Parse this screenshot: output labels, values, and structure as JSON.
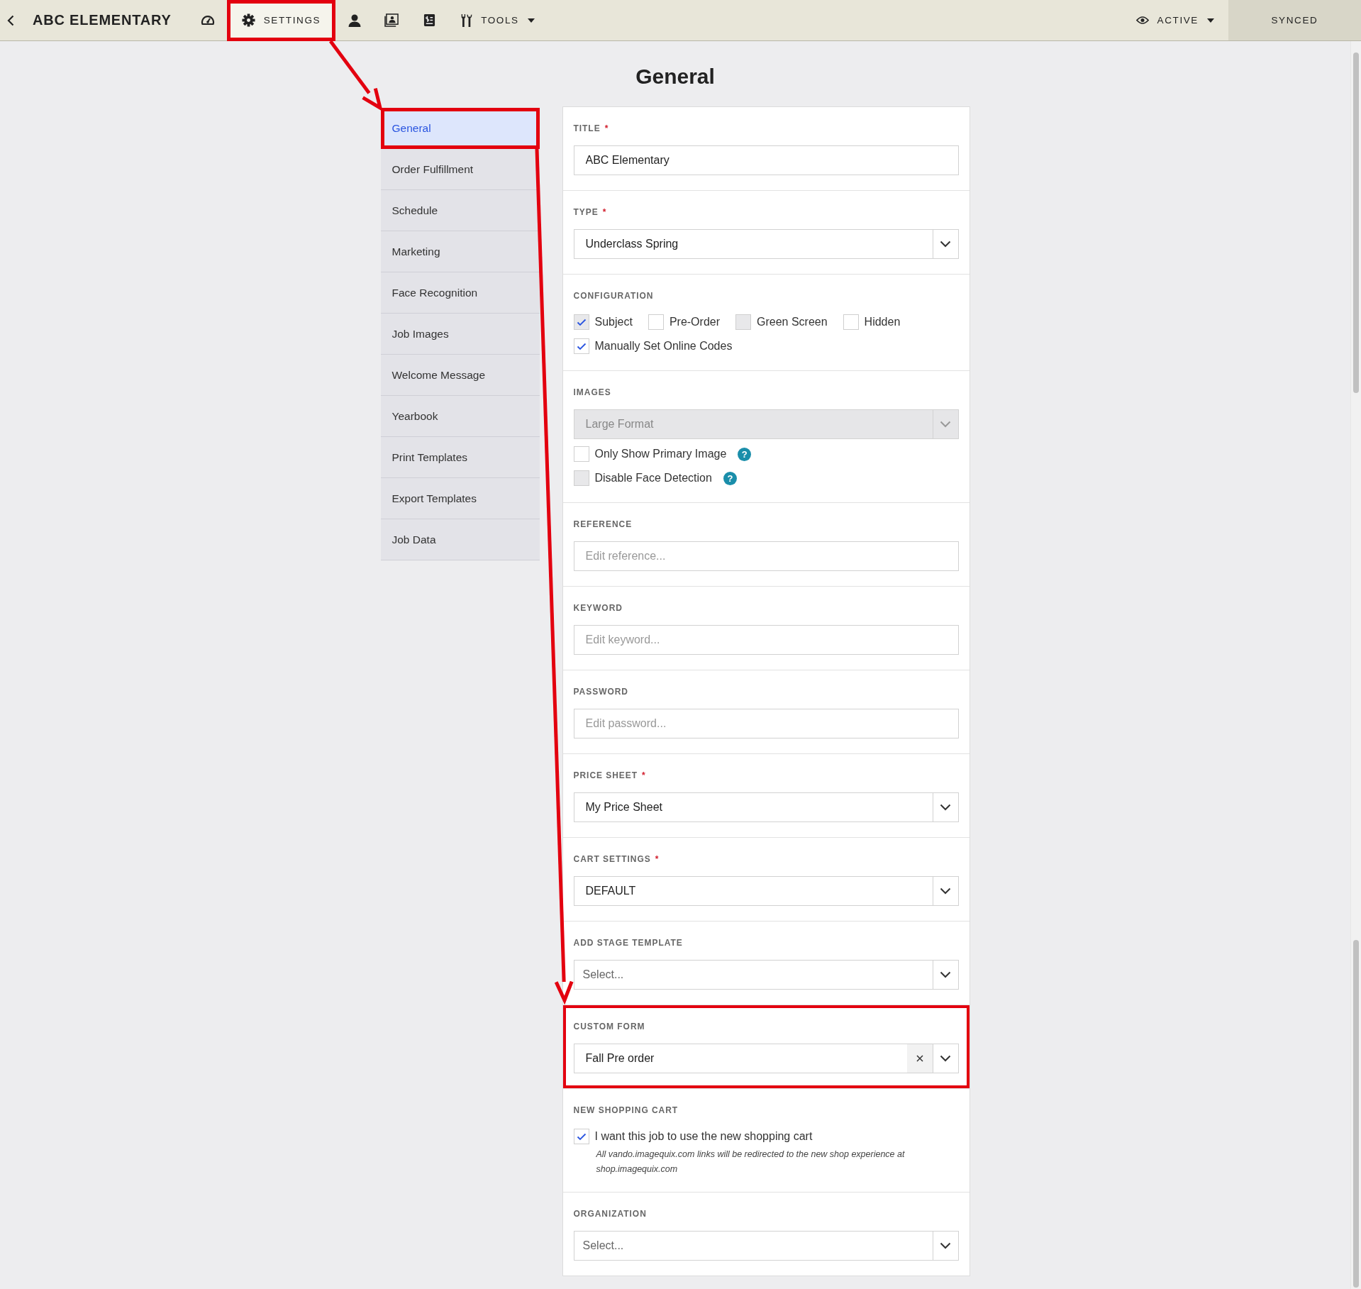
{
  "topbar": {
    "title": "ABC ELEMENTARY",
    "nav": [
      {
        "selected": false,
        "highlighted": false
      },
      {
        "label": "SETTINGS",
        "selected": true,
        "highlighted": true
      },
      {
        "selected": false,
        "highlighted": false
      },
      {
        "selected": false,
        "highlighted": false
      },
      {
        "selected": false,
        "highlighted": false
      },
      {
        "label": "TOOLS",
        "selected": false,
        "highlighted": false,
        "dropdown": true
      }
    ],
    "status": {
      "label": "ACTIVE",
      "dropdown": true
    },
    "sync": "SYNCED"
  },
  "heading": "General",
  "sidebar": {
    "items": [
      {
        "label": "General",
        "selected": true,
        "highlighted": true
      },
      {
        "label": "Order Fulfillment",
        "selected": false,
        "highlighted": false
      },
      {
        "label": "Schedule",
        "selected": false,
        "highlighted": false
      },
      {
        "label": "Marketing",
        "selected": false,
        "highlighted": false
      },
      {
        "label": "Face Recognition",
        "selected": false,
        "highlighted": false
      },
      {
        "label": "Job Images",
        "selected": false,
        "highlighted": false
      },
      {
        "label": "Welcome Message",
        "selected": false,
        "highlighted": false
      },
      {
        "label": "Yearbook",
        "selected": false,
        "highlighted": false
      },
      {
        "label": "Print Templates",
        "selected": false,
        "highlighted": false
      },
      {
        "label": "Export Templates",
        "selected": false,
        "highlighted": false
      },
      {
        "label": "Job Data",
        "selected": false,
        "highlighted": false
      }
    ]
  },
  "sections": [
    {
      "label": "TITLE",
      "required_mark": "*",
      "highlighted": false,
      "controls": [
        {
          "kind": "text",
          "value": "ABC Elementary"
        }
      ]
    },
    {
      "label": "TYPE",
      "required_mark": "*",
      "highlighted": false,
      "controls": [
        {
          "kind": "select",
          "value": "Underclass Spring",
          "disabled": false,
          "clearable": false
        }
      ]
    },
    {
      "label": "CONFIGURATION",
      "highlighted": false,
      "controls": [
        {
          "kind": "checkbox_row",
          "items": [
            {
              "label": "Subject",
              "checked": true,
              "disabled": true
            },
            {
              "label": "Pre-Order",
              "checked": false,
              "disabled": false
            },
            {
              "label": "Green Screen",
              "checked": false,
              "disabled": true
            },
            {
              "label": "Hidden",
              "checked": false,
              "disabled": false
            }
          ]
        },
        {
          "kind": "checkbox_row",
          "items": [
            {
              "label": "Manually Set Online Codes",
              "checked": true,
              "disabled": false
            }
          ]
        }
      ]
    },
    {
      "label": "IMAGES",
      "highlighted": false,
      "controls": [
        {
          "kind": "select",
          "value": "Large Format",
          "disabled": true,
          "clearable": false
        },
        {
          "kind": "checkbox_row",
          "items": [
            {
              "label": "Only Show Primary Image",
              "checked": false,
              "disabled": false,
              "help": "?"
            }
          ]
        },
        {
          "kind": "checkbox_row",
          "items": [
            {
              "label": "Disable Face Detection",
              "checked": false,
              "disabled": true,
              "help": "?"
            }
          ]
        }
      ]
    },
    {
      "label": "REFERENCE",
      "highlighted": false,
      "controls": [
        {
          "kind": "text",
          "placeholder": "Edit reference..."
        }
      ]
    },
    {
      "label": "KEYWORD",
      "highlighted": false,
      "controls": [
        {
          "kind": "text",
          "placeholder": "Edit keyword..."
        }
      ]
    },
    {
      "label": "PASSWORD",
      "highlighted": false,
      "controls": [
        {
          "kind": "text",
          "placeholder": "Edit password..."
        }
      ]
    },
    {
      "label": "PRICE SHEET",
      "required_mark": "*",
      "highlighted": false,
      "controls": [
        {
          "kind": "select",
          "value": "My Price Sheet",
          "disabled": false,
          "clearable": false
        }
      ]
    },
    {
      "label": "CART SETTINGS",
      "required_mark": "*",
      "highlighted": false,
      "controls": [
        {
          "kind": "select",
          "value": "DEFAULT",
          "disabled": false,
          "clearable": false
        }
      ]
    },
    {
      "label": "ADD STAGE TEMPLATE",
      "highlighted": false,
      "controls": [
        {
          "kind": "select",
          "placeholder": "Select...",
          "disabled": false,
          "clearable": false
        }
      ]
    },
    {
      "label": "CUSTOM FORM",
      "highlighted": true,
      "controls": [
        {
          "kind": "select",
          "value": "Fall Pre order",
          "disabled": false,
          "clearable": true
        }
      ]
    },
    {
      "label": "NEW SHOPPING CART",
      "highlighted": false,
      "controls": [
        {
          "kind": "checkbox_row",
          "items": [
            {
              "label": "I want this job to use the new shopping cart",
              "checked": true,
              "disabled": false
            }
          ]
        },
        {
          "kind": "note",
          "text": "All vando.imagequix.com links will be redirected to the new shop experience at shop.imagequix.com"
        }
      ]
    },
    {
      "label": "ORGANIZATION",
      "highlighted": false,
      "controls": [
        {
          "kind": "select",
          "placeholder": "Select...",
          "disabled": false,
          "clearable": false
        }
      ]
    }
  ]
}
